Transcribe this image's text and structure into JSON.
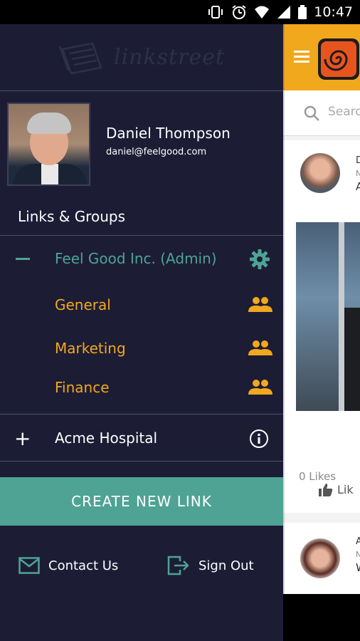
{
  "status_bar": {
    "time": "10:47",
    "icons": [
      "vibrate-icon",
      "alarm-icon",
      "wifi-icon",
      "signal-icon",
      "battery-icon"
    ]
  },
  "colors": {
    "drawer_bg": "#1c1d35",
    "accent_teal": "#4fa394",
    "accent_orange": "#f2a81d",
    "text_white": "#ffffff"
  },
  "drawer": {
    "brand": "linkstreet",
    "profile": {
      "name": "Daniel Thompson",
      "email": "daniel@feelgood.com"
    },
    "section_title": "Links & Groups",
    "organizations": [
      {
        "name": "Feel Good Inc. (Admin)",
        "expanded": true,
        "groups": [
          "General",
          "Marketing",
          "Finance"
        ]
      },
      {
        "name": "Acme Hospital",
        "expanded": false
      }
    ],
    "create_button": "CREATE NEW LINK",
    "footer": {
      "contact": "Contact Us",
      "signout": "Sign Out"
    }
  },
  "background_app": {
    "search_placeholder": "Searc",
    "post_initial": "D",
    "post_initial_2": "N",
    "post_initial_3": "A",
    "likes": "0 Likes",
    "like_button": "Lik",
    "post2_initial": "A",
    "post2_initial_2": "N",
    "post2_initial_3": "W"
  }
}
